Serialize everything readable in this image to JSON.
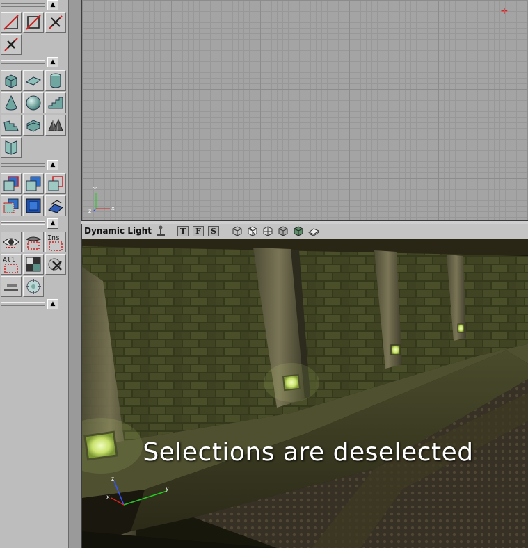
{
  "window": {
    "title": ""
  },
  "toolbox": {
    "groups": [
      {
        "collapse_label": "▲",
        "tools": [
          "add-volume-icon",
          "subtract-volume-icon",
          "intersect-icon",
          "deintersect-icon"
        ]
      },
      {
        "collapse_label": "▲",
        "tools": [
          "cube-brush-icon",
          "sheet-brush-icon",
          "cylinder-brush-icon",
          "cone-brush-icon",
          "sphere-brush-icon",
          "linear-stair-icon",
          "curved-stair-icon",
          "spiral-stair-icon",
          "terrain-brush-icon",
          "volumetric-brush-icon"
        ]
      },
      {
        "collapse_label": "▲",
        "tools": [
          "add-brush-icon",
          "subtract-brush-icon",
          "intersect-brush-icon",
          "deintersect-brush-icon",
          "add-special-brush-icon",
          "add-mover-icon"
        ]
      },
      {
        "collapse_label": "▲",
        "tools": [
          "show-selected-icon",
          "hide-selected-icon",
          "select-inside-icon",
          "select-all-icon",
          "invert-selection-icon",
          "select-none-icon",
          "grid-options-icon",
          "camera-alignment-icon"
        ]
      },
      {
        "collapse_label": "▲"
      }
    ],
    "text_buttons": {
      "insert": "Ins",
      "all": "All"
    }
  },
  "top_viewport": {
    "axis_labels": {
      "y": "Y",
      "x": "x",
      "z": "z"
    }
  },
  "perspective_viewport": {
    "mode_label": "Dynamic Light",
    "view_buttons": [
      "T",
      "F",
      "S"
    ],
    "render_icons": [
      "wireframe-icon",
      "zone-icon",
      "bsp-cuts-icon",
      "textured-icon",
      "dynamic-light-icon",
      "lighting-only-icon"
    ],
    "caption": "Selections are deselected",
    "axis_labels": {
      "z": "z",
      "x": "x",
      "y": "y"
    }
  },
  "colors": {
    "panel": "#bdbdbd",
    "grid_bg": "#a4a4a4",
    "accent_red": "#e02020"
  }
}
